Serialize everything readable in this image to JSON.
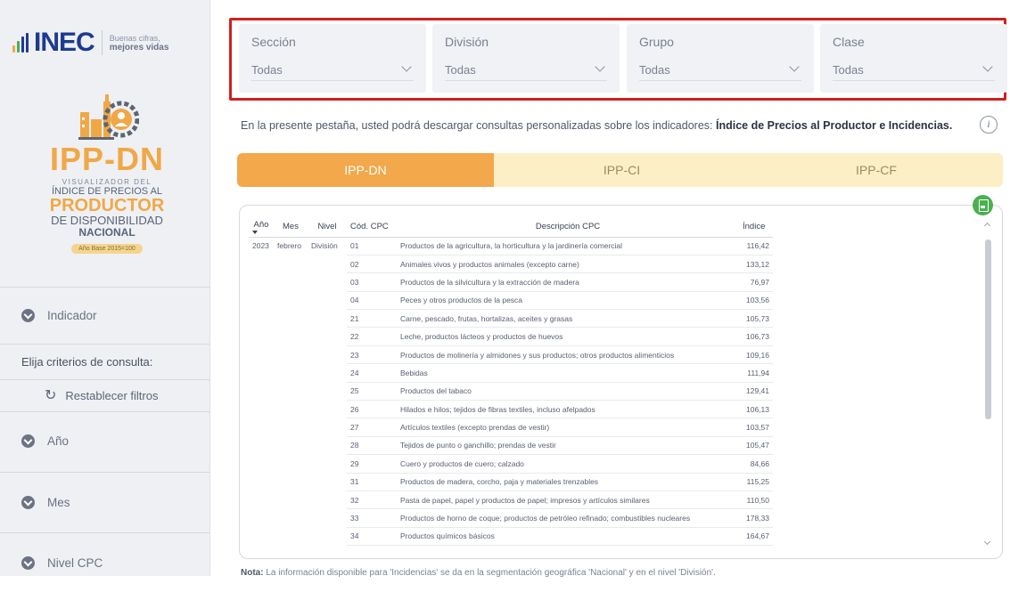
{
  "sidebar": {
    "logo_word": "INEC",
    "slogan_line1": "Buenas cifras,",
    "slogan_line2": "mejores vidas",
    "product": {
      "title": "IPP-DN",
      "line1": "VISUALIZADOR DEL",
      "line2": "ÍNDICE DE PRECIOS AL",
      "line3": "PRODUCTOR",
      "line4": "DE DISPONIBILIDAD",
      "line5": "NACIONAL",
      "base": "Año Base 2015=100"
    },
    "items": [
      {
        "label": "Indicador"
      },
      {
        "label": "Año"
      },
      {
        "label": "Mes"
      },
      {
        "label": "Nivel CPC"
      }
    ],
    "criteria_label": "Elija criterios de consulta:",
    "reset_label": "Restablecer filtros"
  },
  "filters": [
    {
      "label": "Sección",
      "value": "Todas"
    },
    {
      "label": "División",
      "value": "Todas"
    },
    {
      "label": "Grupo",
      "value": "Todas"
    },
    {
      "label": "Clase",
      "value": "Todas"
    }
  ],
  "intro": {
    "text": "En la presente pestaña, usted podrá descargar consultas personalizadas sobre los indicadores:",
    "bold": "Índice de Precios al Productor e Incidencias."
  },
  "tabs": [
    {
      "label": "IPP-DN",
      "active": true
    },
    {
      "label": "IPP-CI",
      "active": false
    },
    {
      "label": "IPP-CF",
      "active": false
    }
  ],
  "table": {
    "headers": {
      "anio": "Año",
      "mes": "Mes",
      "nivel": "Nivel",
      "cod": "Cód. CPC",
      "desc": "Descripción CPC",
      "ind": "Índice"
    },
    "first_row": {
      "anio": "2023",
      "mes": "febrero",
      "nivel": "División"
    },
    "rows": [
      {
        "cod": "01",
        "desc": "Productos de la agricultura, la horticultura y la jardinería comercial",
        "ind": "116,42"
      },
      {
        "cod": "02",
        "desc": "Animales vivos y productos animales (excepto carne)",
        "ind": "133,12"
      },
      {
        "cod": "03",
        "desc": "Productos de la silvicultura y la extracción de madera",
        "ind": "76,97"
      },
      {
        "cod": "04",
        "desc": "Peces y otros productos de la pesca",
        "ind": "103,56"
      },
      {
        "cod": "21",
        "desc": "Carne, pescado, frutas, hortalizas, aceites y grasas",
        "ind": "105,73"
      },
      {
        "cod": "22",
        "desc": "Leche, productos lácteos y productos de huevos",
        "ind": "106,73"
      },
      {
        "cod": "23",
        "desc": "Productos de molinería y almidones y sus productos; otros productos alimenticios",
        "ind": "109,16"
      },
      {
        "cod": "24",
        "desc": "Bebidas",
        "ind": "111,94"
      },
      {
        "cod": "25",
        "desc": "Productos del tabaco",
        "ind": "129,41"
      },
      {
        "cod": "26",
        "desc": "Hilados e hilos; tejidos de fibras textiles, incluso afelpados",
        "ind": "106,13"
      },
      {
        "cod": "27",
        "desc": "Artículos textiles (excepto prendas de vestir)",
        "ind": "103,57"
      },
      {
        "cod": "28",
        "desc": "Tejidos de punto o ganchillo; prendas de vestir",
        "ind": "105,47"
      },
      {
        "cod": "29",
        "desc": "Cuero y productos de cuero; calzado",
        "ind": "84,66"
      },
      {
        "cod": "31",
        "desc": "Productos de madera, corcho, paja y materiales trenzables",
        "ind": "115,25"
      },
      {
        "cod": "32",
        "desc": "Pasta de papel, papel y productos de papel; impresos y artículos similares",
        "ind": "110,50"
      },
      {
        "cod": "33",
        "desc": "Productos de horno de coque; productos de petróleo refinado; combustibles nucleares",
        "ind": "178,33"
      },
      {
        "cod": "34",
        "desc": "Productos químicos básicos",
        "ind": "164,67"
      }
    ]
  },
  "note": {
    "label": "Nota:",
    "text": "La información disponible para 'Incidencias' se da en la segmentación geográfica 'Nacional' y en el nivel 'División'."
  },
  "colors": {
    "accent": "#f2a84b",
    "accent_light": "#fcefc5",
    "brand_blue": "#1d3b8f",
    "highlight_frame": "#d0201e",
    "save_green": "#4caf50"
  },
  "icons": [
    "chevron-down-icon",
    "reset-icon",
    "info-icon",
    "save-icon",
    "sort-arrow-icon"
  ]
}
